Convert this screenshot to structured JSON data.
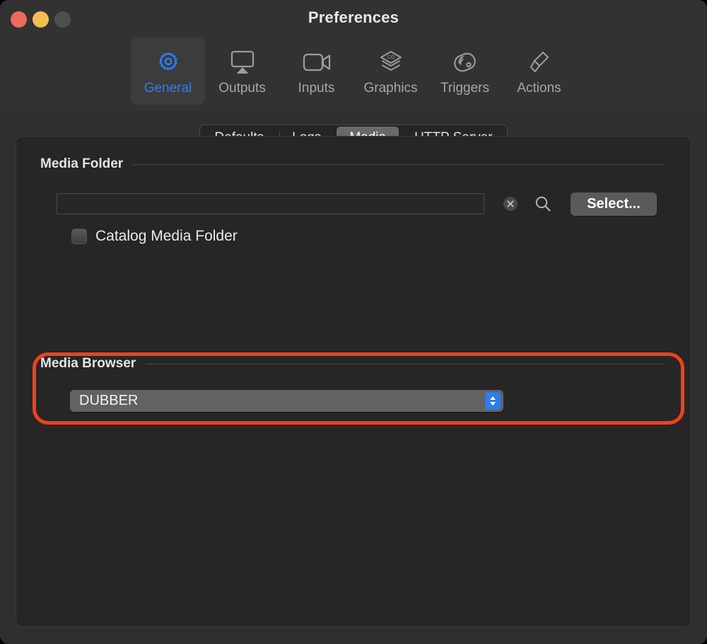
{
  "window": {
    "title": "Preferences",
    "traffic_lights": [
      {
        "name": "close",
        "color": "#ec6a5e"
      },
      {
        "name": "minimize",
        "color": "#f4bd4f"
      },
      {
        "name": "zoom",
        "color": "#4f4f4f"
      }
    ]
  },
  "toolbar": {
    "items": [
      {
        "label": "General",
        "icon": "gear-icon",
        "selected": true
      },
      {
        "label": "Outputs",
        "icon": "airplay-icon",
        "selected": false
      },
      {
        "label": "Inputs",
        "icon": "video-camera-icon",
        "selected": false
      },
      {
        "label": "Graphics",
        "icon": "layers-cg-icon",
        "selected": false
      },
      {
        "label": "Triggers",
        "icon": "signal-puck-icon",
        "selected": false
      },
      {
        "label": "Actions",
        "icon": "action-bolt-icon",
        "selected": false
      }
    ],
    "selected_color": "#2d7cf6",
    "label_color": "#a6a6a6"
  },
  "tabs": {
    "items": [
      {
        "label": "Defaults",
        "active": false
      },
      {
        "label": "Logs",
        "active": false
      },
      {
        "label": "Media",
        "active": true
      },
      {
        "label": "HTTP Server",
        "active": false
      }
    ]
  },
  "media_folder": {
    "group_title": "Media Folder",
    "path_value": "",
    "path_placeholder": "",
    "clear_icon": "clear-circle-icon",
    "search_icon": "search-icon",
    "select_button": "Select...",
    "catalog_checkbox": {
      "label": "Catalog Media Folder",
      "checked": false
    }
  },
  "media_browser": {
    "group_title": "Media Browser",
    "selected_value": "DUBBER",
    "options": [
      "DUBBER"
    ],
    "chevron_icon": "chevron-up-down-icon",
    "chevron_color": "#2f7ceb",
    "highlight_color": "#f1401f"
  }
}
